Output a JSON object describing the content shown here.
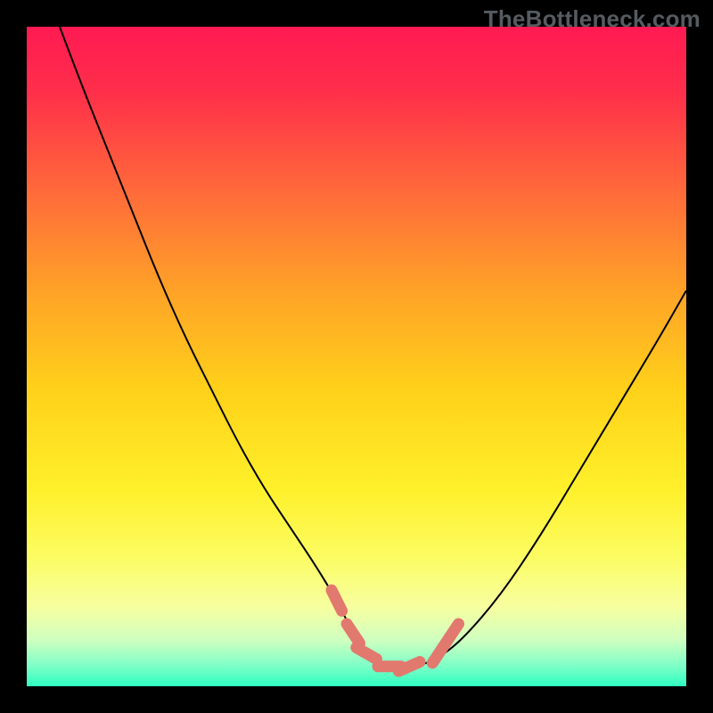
{
  "watermark": "TheBottleneck.com",
  "chart_data": {
    "type": "line",
    "title": "",
    "xlabel": "",
    "ylabel": "",
    "xlim": [
      0,
      100
    ],
    "ylim": [
      0,
      100
    ],
    "grid": false,
    "legend": false,
    "background_gradient": {
      "stops": [
        {
          "offset": 0.0,
          "color": "#ff1a52"
        },
        {
          "offset": 0.1,
          "color": "#ff2f4a"
        },
        {
          "offset": 0.25,
          "color": "#ff6a3a"
        },
        {
          "offset": 0.4,
          "color": "#ffa227"
        },
        {
          "offset": 0.55,
          "color": "#ffd11a"
        },
        {
          "offset": 0.7,
          "color": "#fff02a"
        },
        {
          "offset": 0.8,
          "color": "#fcfc60"
        },
        {
          "offset": 0.88,
          "color": "#f7ffa0"
        },
        {
          "offset": 0.93,
          "color": "#cfffc0"
        },
        {
          "offset": 0.97,
          "color": "#7cffc8"
        },
        {
          "offset": 1.0,
          "color": "#2effc0"
        }
      ]
    },
    "series": [
      {
        "name": "bottleneck-curve",
        "type": "line",
        "color": "#000000",
        "x": [
          5,
          8,
          12,
          16,
          20,
          24,
          28,
          32,
          36,
          40,
          44,
          47,
          49,
          51,
          53,
          55,
          57,
          59,
          62,
          66,
          72,
          78,
          84,
          90,
          96,
          100
        ],
        "y": [
          100,
          92,
          82,
          72,
          62,
          53,
          45,
          37,
          30,
          24,
          18,
          13,
          9,
          6,
          4,
          3,
          3,
          3,
          4,
          7,
          14,
          23,
          33,
          43,
          53,
          60
        ]
      },
      {
        "name": "optimal-range-markers",
        "type": "scatter",
        "color": "#e2796e",
        "shape": "rounded-segment",
        "points": [
          {
            "x": 47.0,
            "y": 13.0
          },
          {
            "x": 49.5,
            "y": 8.0
          },
          {
            "x": 51.5,
            "y": 5.0
          },
          {
            "x": 55.0,
            "y": 3.0
          },
          {
            "x": 58.0,
            "y": 3.0
          },
          {
            "x": 62.5,
            "y": 5.0
          },
          {
            "x": 64.5,
            "y": 8.0
          }
        ]
      }
    ]
  }
}
